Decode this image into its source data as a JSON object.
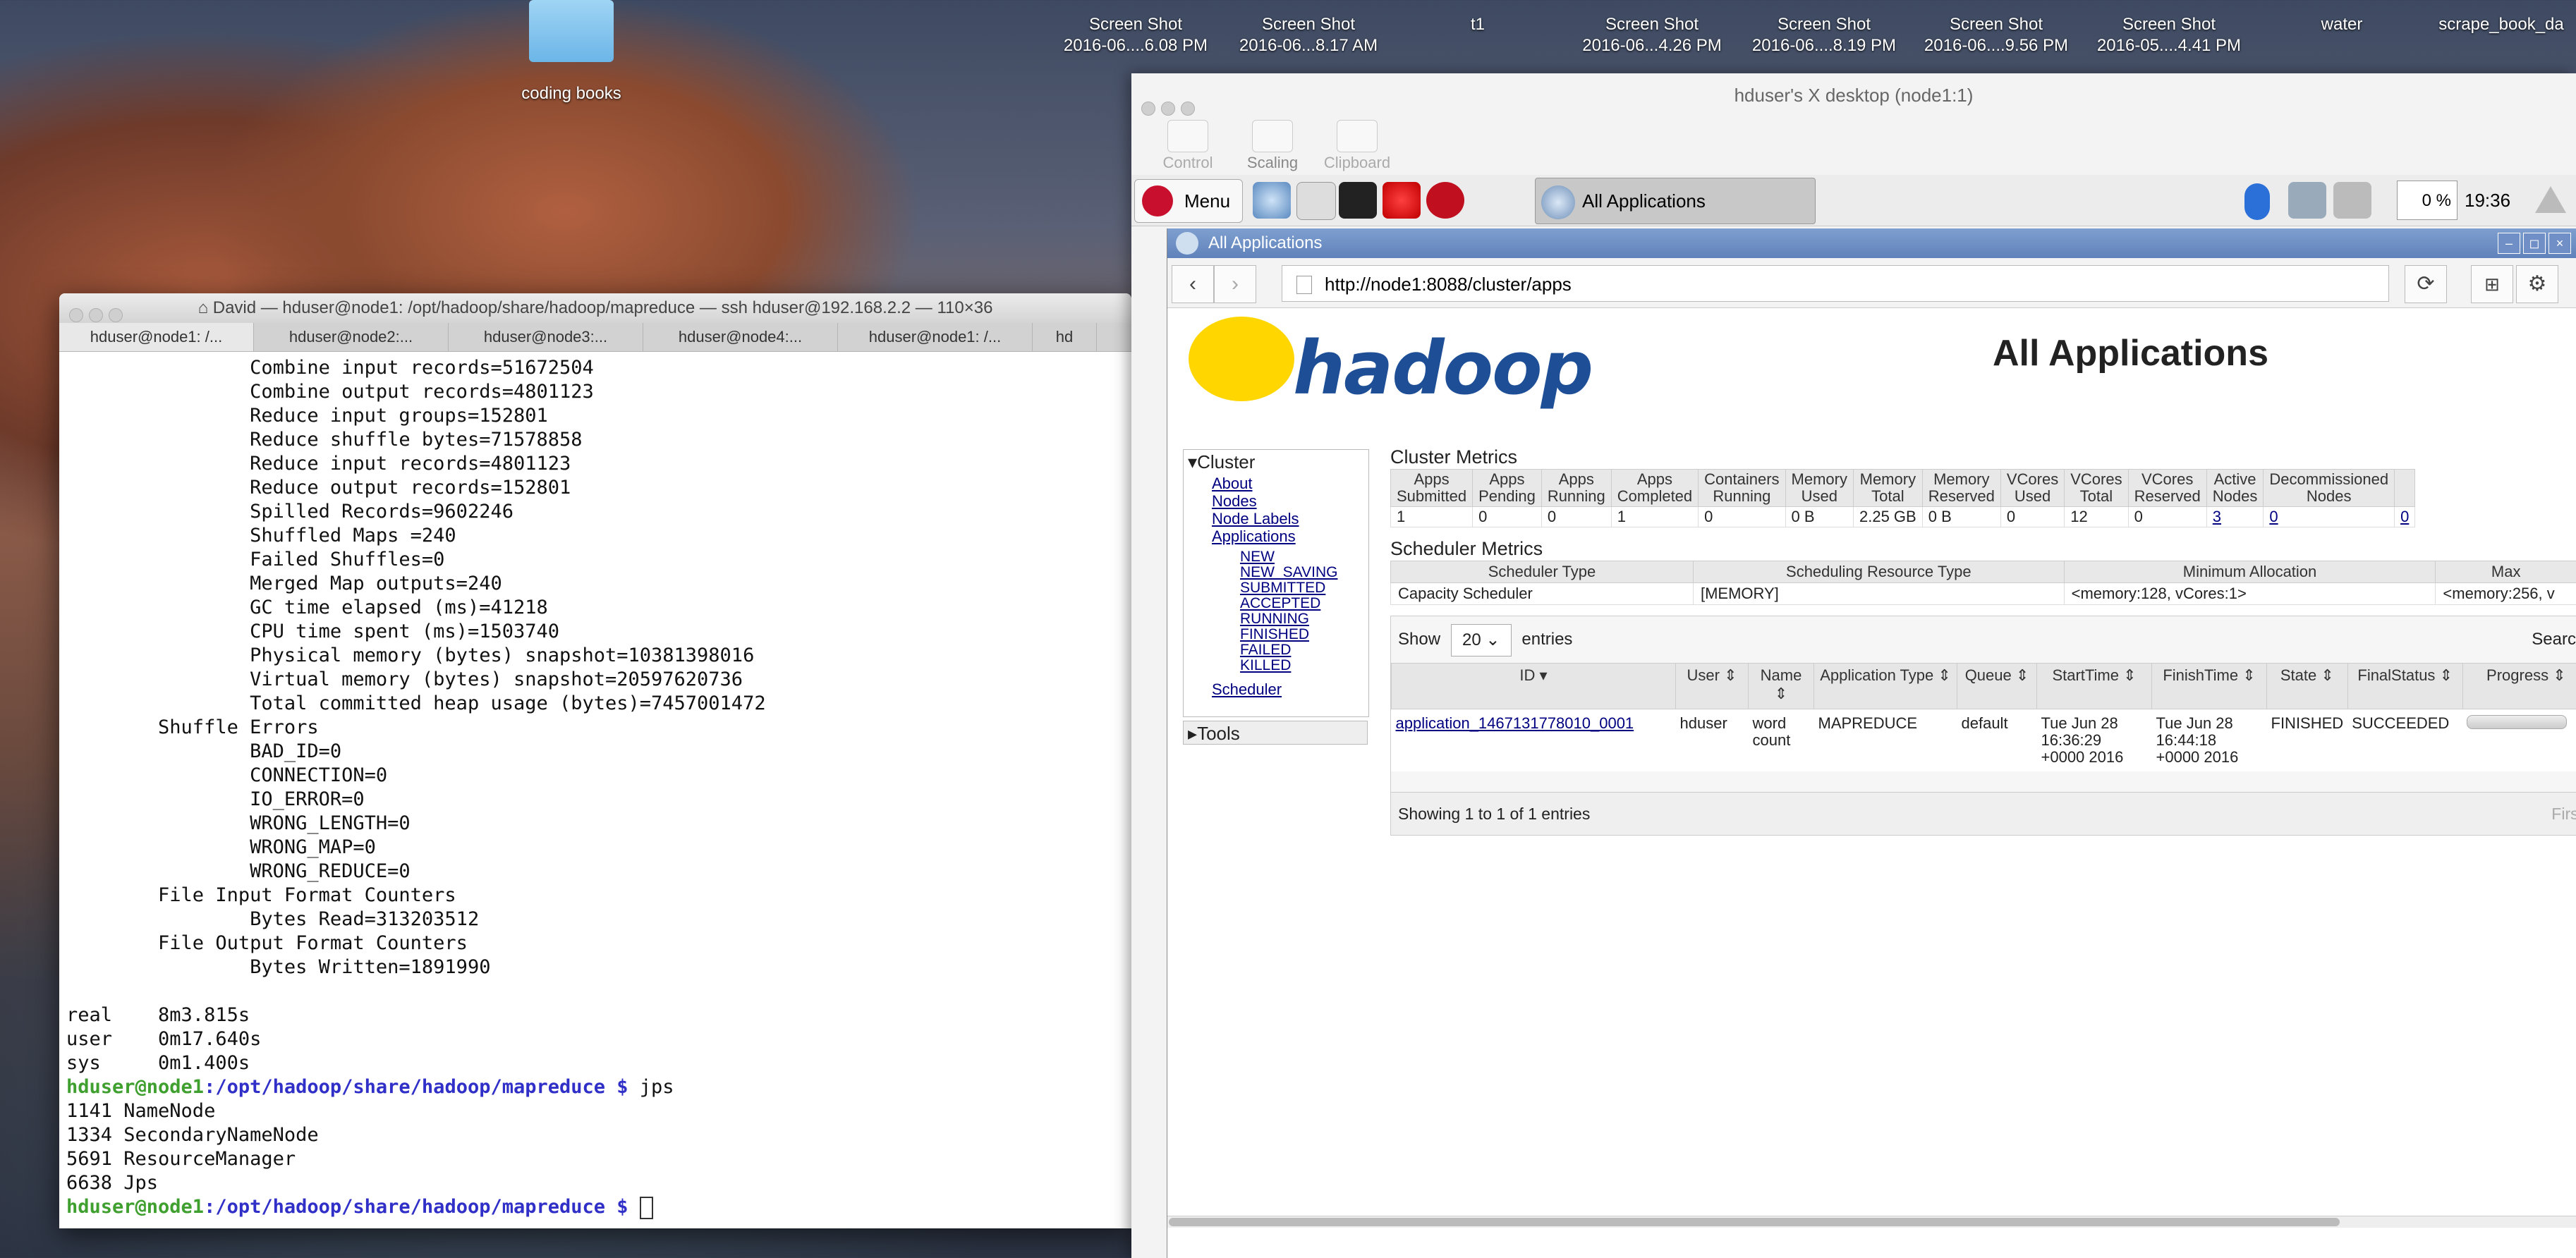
{
  "desktop": {
    "icons": [
      {
        "label": "coding books"
      },
      {
        "label1": "Screen Shot",
        "label2": "2016-06....6.08 PM"
      },
      {
        "label1": "Screen Shot",
        "label2": "2016-06...8.17 AM"
      },
      {
        "label1": "t1",
        "label2": ""
      },
      {
        "label1": "Screen Shot",
        "label2": "2016-06...4.26 PM"
      },
      {
        "label1": "Screen Shot",
        "label2": "2016-06....8.19 PM"
      },
      {
        "label1": "Screen Shot",
        "label2": "2016-06....9.56 PM"
      },
      {
        "label1": "Screen Shot",
        "label2": "2016-05....4.41 PM"
      },
      {
        "label1": "water",
        "label2": ""
      },
      {
        "label1": "scrape_book_da",
        "label2": ""
      }
    ]
  },
  "terminal": {
    "title": "David — hduser@node1: /opt/hadoop/share/hadoop/mapreduce — ssh hduser@192.168.2.2 — 110×36",
    "tabs": [
      "hduser@node1: /...",
      "hduser@node2:...",
      "hduser@node3:...",
      "hduser@node4:...",
      "hduser@node1: /...",
      "hd"
    ],
    "lines": [
      "                Combine input records=51672504",
      "                Combine output records=4801123",
      "                Reduce input groups=152801",
      "                Reduce shuffle bytes=71578858",
      "                Reduce input records=4801123",
      "                Reduce output records=152801",
      "                Spilled Records=9602246",
      "                Shuffled Maps =240",
      "                Failed Shuffles=0",
      "                Merged Map outputs=240",
      "                GC time elapsed (ms)=41218",
      "                CPU time spent (ms)=1503740",
      "                Physical memory (bytes) snapshot=10381398016",
      "                Virtual memory (bytes) snapshot=20597620736",
      "                Total committed heap usage (bytes)=7457001472",
      "        Shuffle Errors",
      "                BAD_ID=0",
      "                CONNECTION=0",
      "                IO_ERROR=0",
      "                WRONG_LENGTH=0",
      "                WRONG_MAP=0",
      "                WRONG_REDUCE=0",
      "        File Input Format Counters",
      "                Bytes Read=313203512",
      "        File Output Format Counters",
      "                Bytes Written=1891990",
      "",
      "real    8m3.815s",
      "user    0m17.640s",
      "sys     0m1.400s"
    ],
    "prompt_user": "hduser@node1",
    "prompt_path": ":/opt/hadoop/share/hadoop/mapreduce $",
    "cmd": " jps",
    "jps": [
      "1141 NameNode",
      "1334 SecondaryNameNode",
      "5691 ResourceManager",
      "6638 Jps"
    ]
  },
  "vnc": {
    "title": "hduser's X desktop (node1:1)",
    "toolbar": [
      "Control",
      "Scaling",
      "Clipboard"
    ],
    "panel": {
      "menu": "Menu",
      "task": "All Applications",
      "cpu": "0 %",
      "time": "19:36"
    }
  },
  "browser": {
    "title": "All Applications",
    "url": "http://node1:8088/cluster/apps",
    "logo": "hadoop",
    "page_title": "All Applications",
    "sidebar": {
      "cluster": "Cluster",
      "links": [
        "About",
        "Nodes",
        "Node Labels",
        "Applications"
      ],
      "states": [
        "NEW",
        "NEW_SAVING",
        "SUBMITTED",
        "ACCEPTED",
        "RUNNING",
        "FINISHED",
        "FAILED",
        "KILLED"
      ],
      "scheduler": "Scheduler",
      "tools": "Tools"
    },
    "cluster_metrics": {
      "label": "Cluster Metrics",
      "headers": [
        [
          "Apps",
          "Submitted"
        ],
        [
          "Apps",
          "Pending"
        ],
        [
          "Apps",
          "Running"
        ],
        [
          "Apps",
          "Completed"
        ],
        [
          "Containers",
          "Running"
        ],
        [
          "Memory",
          "Used"
        ],
        [
          "Memory",
          "Total"
        ],
        [
          "Memory",
          "Reserved"
        ],
        [
          "VCores",
          "Used"
        ],
        [
          "VCores",
          "Total"
        ],
        [
          "VCores",
          "Reserved"
        ],
        [
          "Active",
          "Nodes"
        ],
        [
          "Decommissioned",
          "Nodes"
        ],
        [
          "",
          ""
        ]
      ],
      "values": [
        "1",
        "0",
        "0",
        "1",
        "0",
        "0 B",
        "2.25 GB",
        "0 B",
        "0",
        "12",
        "0",
        "3",
        "0",
        "0"
      ]
    },
    "scheduler_metrics": {
      "label": "Scheduler Metrics",
      "headers": [
        "Scheduler Type",
        "Scheduling Resource Type",
        "Minimum Allocation",
        "Max"
      ],
      "values": [
        "Capacity Scheduler",
        "[MEMORY]",
        "<memory:128, vCores:1>",
        "<memory:256, v"
      ]
    },
    "show": {
      "prefix": "Show",
      "value": "20",
      "suffix": "entries",
      "search": "Search:"
    },
    "apps": {
      "headers": [
        "ID",
        "User",
        "Name",
        "Application Type",
        "Queue",
        "StartTime",
        "FinishTime",
        "State",
        "FinalStatus",
        "Progress"
      ],
      "rows": [
        {
          "id": "application_1467131778010_0001",
          "user": "hduser",
          "name": "word count",
          "type": "MAPREDUCE",
          "queue": "default",
          "start": "Tue Jun 28 16:36:29 +0000 2016",
          "finish": "Tue Jun 28 16:44:18 +0000 2016",
          "state": "FINISHED",
          "final": "SUCCEEDED",
          "progress": 1.0
        }
      ]
    },
    "footer": {
      "showing": "Showing 1 to 1 of 1 entries",
      "first": "First"
    }
  }
}
